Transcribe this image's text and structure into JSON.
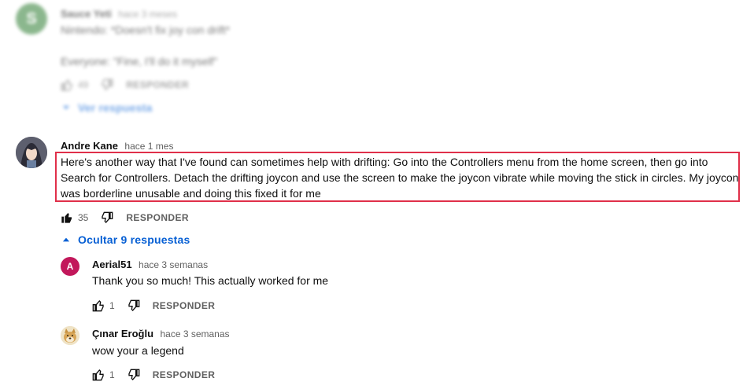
{
  "top_comment": {
    "avatar_letter": "S",
    "author": "Sauce Yeti",
    "time": "hace 3 meses",
    "line1": "Nintendo: *Doesn't fix joy con drift*",
    "line2": "Everyone: \"Fine, I'll do it myself\"",
    "likes": "49",
    "reply_label": "RESPONDER",
    "view_replies": "Ver respuesta"
  },
  "main_comment": {
    "author": "Andre Kane",
    "time": "hace 1 mes",
    "text": "Here's another way that I've found can sometimes help with drifting: Go into the Controllers menu from the home screen, then go into Search for Controllers. Detach the drifting joycon and use the screen to make the joycon vibrate while moving the stick in circles. My joycon was borderline unusable and doing this fixed it for me",
    "likes": "35",
    "reply_label": "RESPONDER",
    "hide_replies": "Ocultar 9 respuestas"
  },
  "replies": [
    {
      "avatar_letter": "A",
      "author": "Aerial51",
      "time": "hace 3 semanas",
      "text": "Thank you so much! This actually worked for me",
      "likes": "1",
      "reply_label": "RESPONDER"
    },
    {
      "author": "Çınar Eroğlu",
      "time": "hace 3 semanas",
      "text": "wow your a legend",
      "likes": "1",
      "reply_label": "RESPONDER"
    }
  ],
  "colors": {
    "accent": "#065fd4",
    "highlight": "#e0304a",
    "avatar_s": "#2e7d32",
    "avatar_a": "#c2185b"
  }
}
